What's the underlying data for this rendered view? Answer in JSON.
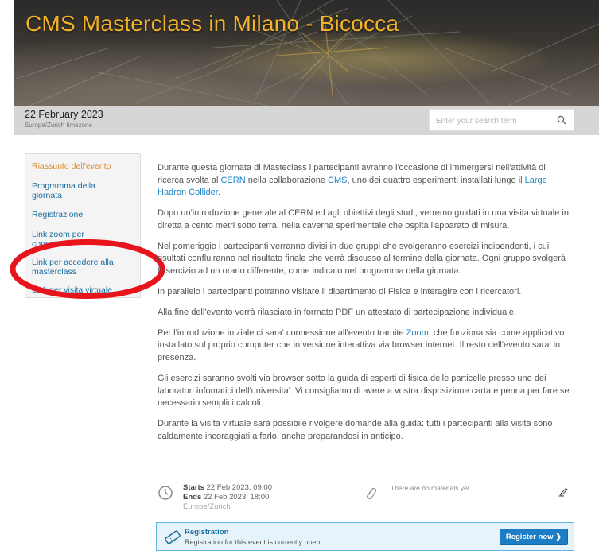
{
  "banner": {
    "title": "CMS Masterclass in Milano - Bicocca"
  },
  "header": {
    "date": "22 February 2023",
    "timezone": "Europe/Zurich timezone",
    "search_placeholder": "Enter your search term"
  },
  "sidebar": {
    "items": [
      {
        "label": "Riassunto dell'evento",
        "active": true
      },
      {
        "label": "Programma della giornata"
      },
      {
        "label": "Registrazione"
      },
      {
        "label": "Link zoom per connettersi"
      },
      {
        "label": "Link per accedere alla masterclass"
      },
      {
        "label": "Link per visita virtuale"
      }
    ]
  },
  "description": {
    "p1_a": "Durante questa giornata di Masteclass i partecipanti avranno l'occasione di immergersi nell'attività di ricerca svolta al ",
    "p1_link1": "CERN",
    "p1_b": " nella collaborazione ",
    "p1_link2": "CMS",
    "p1_c": ", uno dei quattro esperimenti installati lungo il ",
    "p1_link3": "Large Hadron Collider",
    "p1_d": ".",
    "p2": "Dopo un'introduzione generale al CERN ed agli obiettivi degli studi, verremo guidati in una visita virtuale in diretta a cento metri sotto terra, nella caverna sperimentale che ospita l'apparato di misura.",
    "p3": "Nel pomeriggio i partecipanti verranno divisi in due gruppi che svolgeranno esercizi indipendenti, i cui risultati confluiranno nel risultato finale che verrà discusso al termine della giornata. Ogni gruppo svolgerà l'esercizio ad un orario differente, come indicato nel programma della giornata.",
    "p4": "In parallelo i partecipanti potranno visitare il dipartimento di Fisica e interagire con i ricercatori.",
    "p5": "Alla fine dell'evento verrà rilasciato in formato PDF un attestato di partecipazione individuale.",
    "p6_a": "Per l'introduzione iniziale ci sara' connessione all'evento tramite ",
    "p6_link": "Zoom",
    "p6_b": ", che funziona sia come applicativo installato sul proprio computer che in versione interattiva via browser internet. Il resto dell'evento sara' in presenza.",
    "p7": "Gli esercizi saranno svolti via browser sotto la guida di esperti di fisica delle particelle presso uno dei laboratori infomatici dell'universita'. Vi consigliamo di avere a vostra disposizione carta e penna per fare se necessario semplici calcoli.",
    "p8": "Durante la visita virtuale sarà possibile rivolgere domande alla guida: tutti i partecipanti alla visita sono caldamente incoraggiati a farlo, anche preparandosi in anticipo."
  },
  "details": {
    "starts_label": "Starts",
    "starts_value": "22 Feb 2023, 09:00",
    "ends_label": "Ends",
    "ends_value": "22 Feb 2023, 18:00",
    "timezone": "Europe/Zurich",
    "materials": "There are no materials yet."
  },
  "registration": {
    "title": "Registration",
    "text": "Registration for this event is currently open.",
    "button": "Register now",
    "button_arrow": "❯"
  },
  "colors": {
    "title": "#f3b229",
    "link": "#1a85c9",
    "active_menu": "#e08a2e",
    "annotation": "#e8141c",
    "button": "#1d7dc5"
  }
}
